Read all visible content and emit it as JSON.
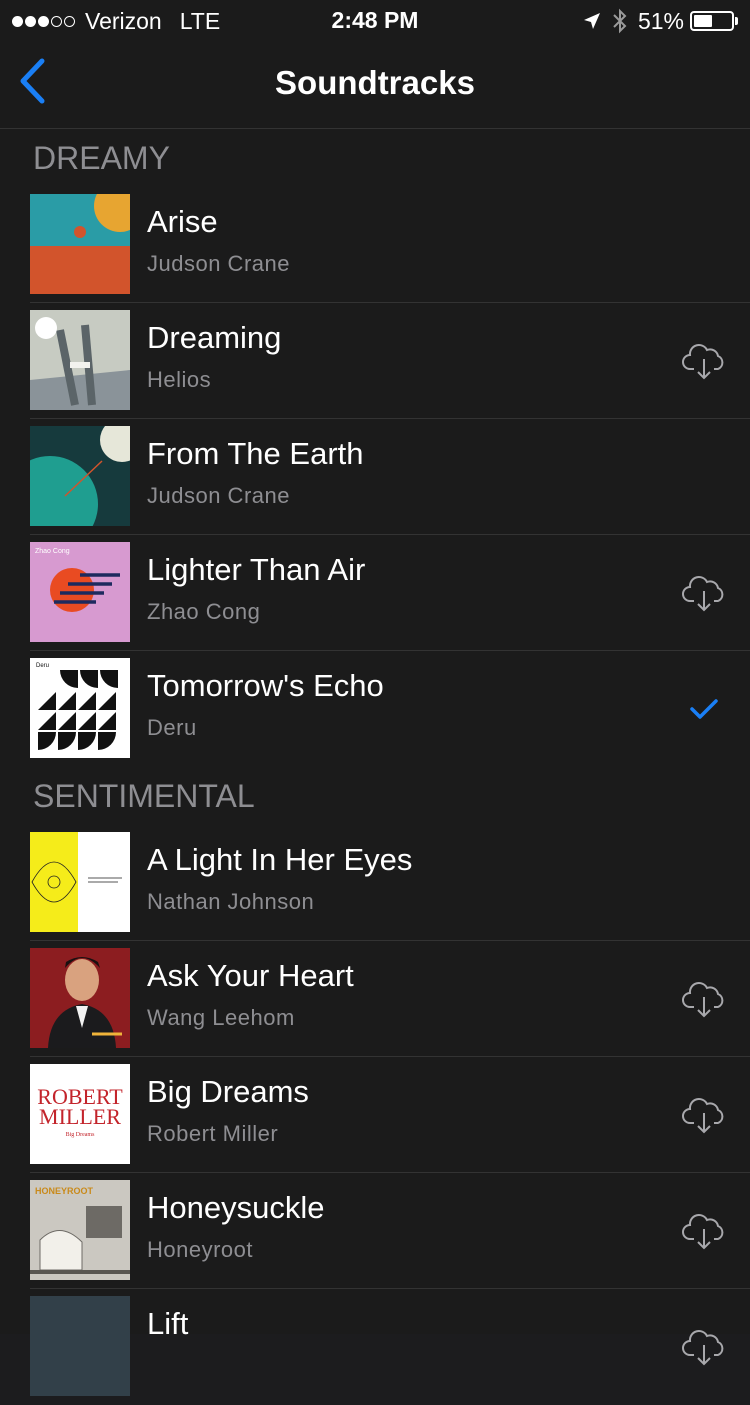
{
  "status_bar": {
    "carrier": "Verizon",
    "network": "LTE",
    "time": "2:48 PM",
    "battery_percent": "51%",
    "battery_level": 0.51,
    "signal_bars_filled": 3,
    "signal_bars_total": 5
  },
  "nav": {
    "title": "Soundtracks",
    "back_icon": "chevron-left-icon"
  },
  "colors": {
    "accent": "#1a7ff5",
    "background": "#1b1b1b",
    "secondary_text": "#8e8e92"
  },
  "sections": [
    {
      "header": "DREAMY",
      "tracks": [
        {
          "title": "Arise",
          "artist": "Judson Crane",
          "action": "none"
        },
        {
          "title": "Dreaming",
          "artist": "Helios",
          "action": "download"
        },
        {
          "title": "From The Earth",
          "artist": "Judson Crane",
          "action": "none"
        },
        {
          "title": "Lighter Than Air",
          "artist": "Zhao Cong",
          "action": "download"
        },
        {
          "title": "Tomorrow's Echo",
          "artist": "Deru",
          "action": "selected"
        }
      ]
    },
    {
      "header": "SENTIMENTAL",
      "tracks": [
        {
          "title": "A Light In Her Eyes",
          "artist": "Nathan Johnson",
          "action": "none"
        },
        {
          "title": "Ask Your Heart",
          "artist": "Wang Leehom",
          "action": "download"
        },
        {
          "title": "Big Dreams",
          "artist": "Robert Miller",
          "action": "download"
        },
        {
          "title": "Honeysuckle",
          "artist": "Honeyroot",
          "action": "download"
        },
        {
          "title": "Lift",
          "artist": "",
          "action": "download"
        }
      ]
    }
  ],
  "cover_text": {
    "zhao_cong": "Zhao Cong",
    "deru": "Deru",
    "robert_miller_line1": "ROBERT",
    "robert_miller_line2": "MILLER",
    "robert_miller_sub": "Big Dreams",
    "honeyroot": "HONEYROOT"
  }
}
